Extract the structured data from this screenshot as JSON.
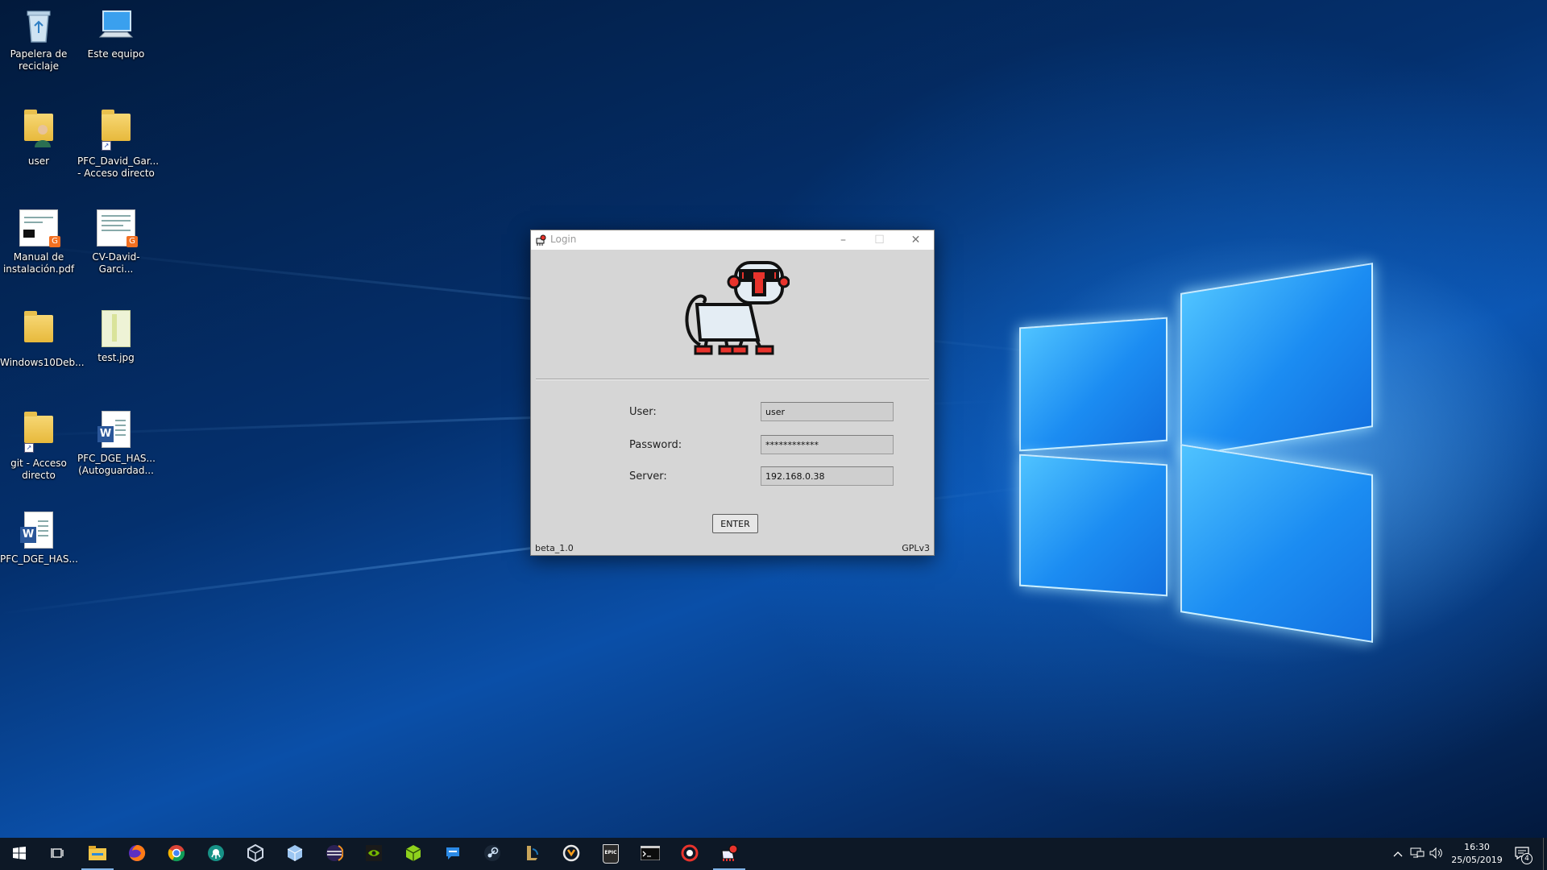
{
  "desktop": {
    "icons": [
      {
        "label": "Papelera de\nreciclaje",
        "icon": "recycle-bin-icon"
      },
      {
        "label": "Este equipo",
        "icon": "this-pc-icon"
      },
      {
        "label": "user",
        "icon": "user-folder-icon"
      },
      {
        "label": "PFC_David_Gar...\n- Acceso directo",
        "icon": "folder-shortcut-icon"
      },
      {
        "label": "Manual de\ninstalación.pdf",
        "icon": "pdf-document-icon"
      },
      {
        "label": "CV-David-Garci...",
        "icon": "pdf-document-icon"
      },
      {
        "label": "Windows10Deb...",
        "icon": "folder-icon"
      },
      {
        "label": "test.jpg",
        "icon": "image-file-icon"
      },
      {
        "label": "git - Acceso\ndirecto",
        "icon": "folder-shortcut-icon"
      },
      {
        "label": "PFC_DGE_HAS...\n(Autoguardad...",
        "icon": "word-document-icon"
      },
      {
        "label": "PFC_DGE_HAS...",
        "icon": "word-document-icon"
      }
    ]
  },
  "login_window": {
    "title": "Login",
    "controls": {
      "minimize": "–",
      "maximize": "☐",
      "close": "✕"
    },
    "mascot": "monkey-mascot-icon",
    "fields": {
      "user_label": "User:",
      "user_value": "user",
      "password_label": "Password:",
      "password_value": "************",
      "server_label": "Server:",
      "server_value": "192.168.0.38"
    },
    "enter_label": "ENTER",
    "version": "beta_1.0",
    "license": "GPLv3"
  },
  "taskbar": {
    "apps": [
      {
        "icon": "start-windows-icon"
      },
      {
        "icon": "task-view-icon"
      },
      {
        "icon": "file-explorer-icon",
        "active": true
      },
      {
        "icon": "firefox-icon"
      },
      {
        "icon": "chrome-icon"
      },
      {
        "icon": "gitkraken-icon"
      },
      {
        "icon": "virtualbox-icon"
      },
      {
        "icon": "cube-app-icon"
      },
      {
        "icon": "eclipse-icon"
      },
      {
        "icon": "nvidia-icon"
      },
      {
        "icon": "sketchup-icon"
      },
      {
        "icon": "chat-app-icon"
      },
      {
        "icon": "steam-icon"
      },
      {
        "icon": "league-icon"
      },
      {
        "icon": "overwatch-icon"
      },
      {
        "icon": "epic-games-icon"
      },
      {
        "icon": "terminal-icon"
      },
      {
        "icon": "record-app-icon"
      },
      {
        "icon": "monkey-app-icon",
        "active": true
      }
    ],
    "epic_text": "EPIC",
    "clock_time": "16:30",
    "clock_date": "25/05/2019",
    "notification_count": "4"
  },
  "colors": {
    "accent": "#7fb2e6",
    "mascot_red": "#e8332c"
  }
}
